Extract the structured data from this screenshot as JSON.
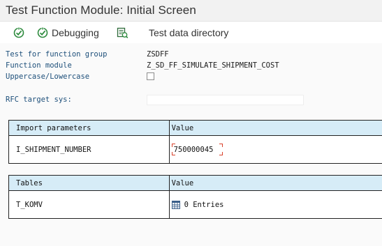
{
  "window": {
    "title": "Test Function Module: Initial Screen"
  },
  "toolbar": {
    "execute_icon": "execute-icon",
    "debugging_label": "Debugging",
    "debugging_icon": "debug-execute-icon",
    "test_data_label": "Test data directory",
    "test_data_icon": "test-data-directory-icon"
  },
  "form": {
    "function_group_label": "Test for function group",
    "function_group_value": "ZSDFF",
    "function_module_label": "Function module",
    "function_module_value": "Z_SD_FF_SIMULATE_SHIPMENT_COST",
    "case_label": "Uppercase/Lowercase",
    "case_checked": false,
    "rfc_label": "RFC target sys:",
    "rfc_value": ""
  },
  "import_table": {
    "headers": [
      "Import parameters",
      "Value"
    ],
    "rows": [
      {
        "param": "I_SHIPMENT_NUMBER",
        "value": "750000045"
      }
    ]
  },
  "tables_table": {
    "headers": [
      "Tables",
      "Value"
    ],
    "rows": [
      {
        "param": "T_KOMV",
        "value": "0 Entries",
        "icon": "table-icon"
      }
    ]
  },
  "colors": {
    "label_blue": "#1d4f7a",
    "header_bg": "#d6ecf7",
    "required_marker": "#d9412b",
    "icon_green": "#2e8b3e"
  }
}
